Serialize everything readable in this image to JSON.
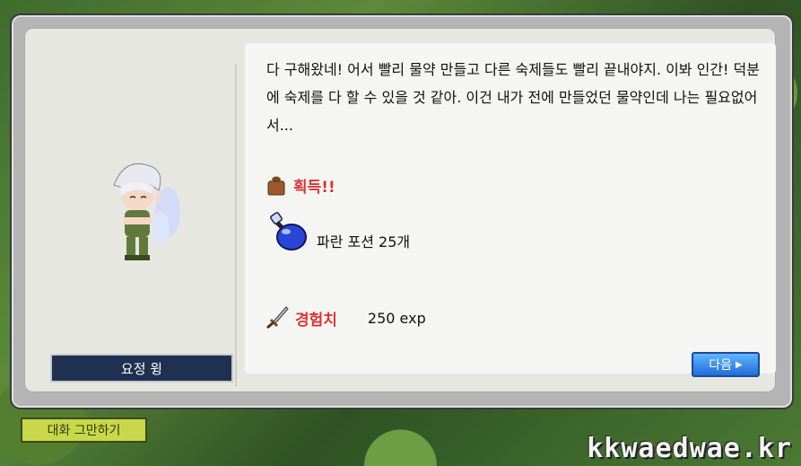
{
  "npc": {
    "name": "요정 윙"
  },
  "dialog": {
    "message": "다 구해왔네! 어서 빨리 물약 만들고 다른 숙제들도 빨리 끝내야지. 이봐 인간! 덕분에 숙제를 다 할 수 있을 것 같아. 이건 내가 전에 만들었던 물약인데 나는 필요없어서...",
    "reward_header": "획득!!",
    "reward_item": "파란 포션 25개",
    "exp_label": "경험치",
    "exp_value": "250 exp",
    "next_label": "다음"
  },
  "end_chat_label": "대화 그만하기",
  "watermark": "kkwaedwae.kr",
  "colors": {
    "npc_name_bg": "#1f3050",
    "reward_red": "#e03030",
    "next_button_blue": "#1f6fd8",
    "end_chat_green": "#c8d84a"
  }
}
